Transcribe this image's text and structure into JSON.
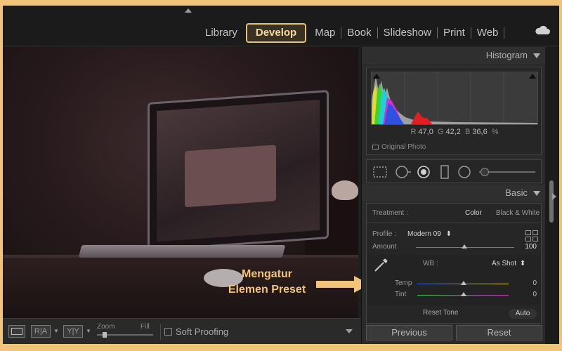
{
  "modules": {
    "items": [
      {
        "label": "Library",
        "active": false
      },
      {
        "label": "Develop",
        "active": true
      },
      {
        "label": "Map",
        "active": false
      },
      {
        "label": "Book",
        "active": false
      },
      {
        "label": "Slideshow",
        "active": false
      },
      {
        "label": "Print",
        "active": false
      },
      {
        "label": "Web",
        "active": false
      }
    ],
    "cloud_icon": "cloud-icon"
  },
  "annotation": {
    "line1": "Mengatur",
    "line2": "Elemen Preset",
    "color": "#f2c47a"
  },
  "histogram": {
    "title": "Histogram",
    "r_label": "R",
    "r_value": "47,0",
    "g_label": "G",
    "g_value": "42,2",
    "b_label": "B",
    "b_value": "36,6",
    "percent": "%",
    "original_photo": "Original Photo"
  },
  "basic": {
    "title": "Basic",
    "treatment_label": "Treatment :",
    "treatment_color": "Color",
    "treatment_bw": "Black & White",
    "profile_label": "Profile :",
    "profile_value": "Modern 09",
    "profile_caret": "⬍",
    "amount_label": "Amount",
    "amount_value": "100",
    "amount_fraction": 1.0,
    "wb_label": "WB :",
    "wb_value": "As Shot",
    "wb_caret": "⬍",
    "temp_label": "Temp",
    "temp_value": "0",
    "tint_label": "Tint",
    "tint_value": "0",
    "reset_tone": "Reset Tone",
    "auto": "Auto"
  },
  "toolbar": {
    "view_ra": "R|A",
    "view_yy": "Y|Y",
    "zoom_label": "Zoom",
    "fill_label": "Fill",
    "soft_proofing": "Soft Proofing"
  },
  "buttons": {
    "previous": "Previous",
    "reset": "Reset"
  },
  "colors": {
    "accent": "#e7c37a",
    "background_frame": "#f2c47a"
  }
}
